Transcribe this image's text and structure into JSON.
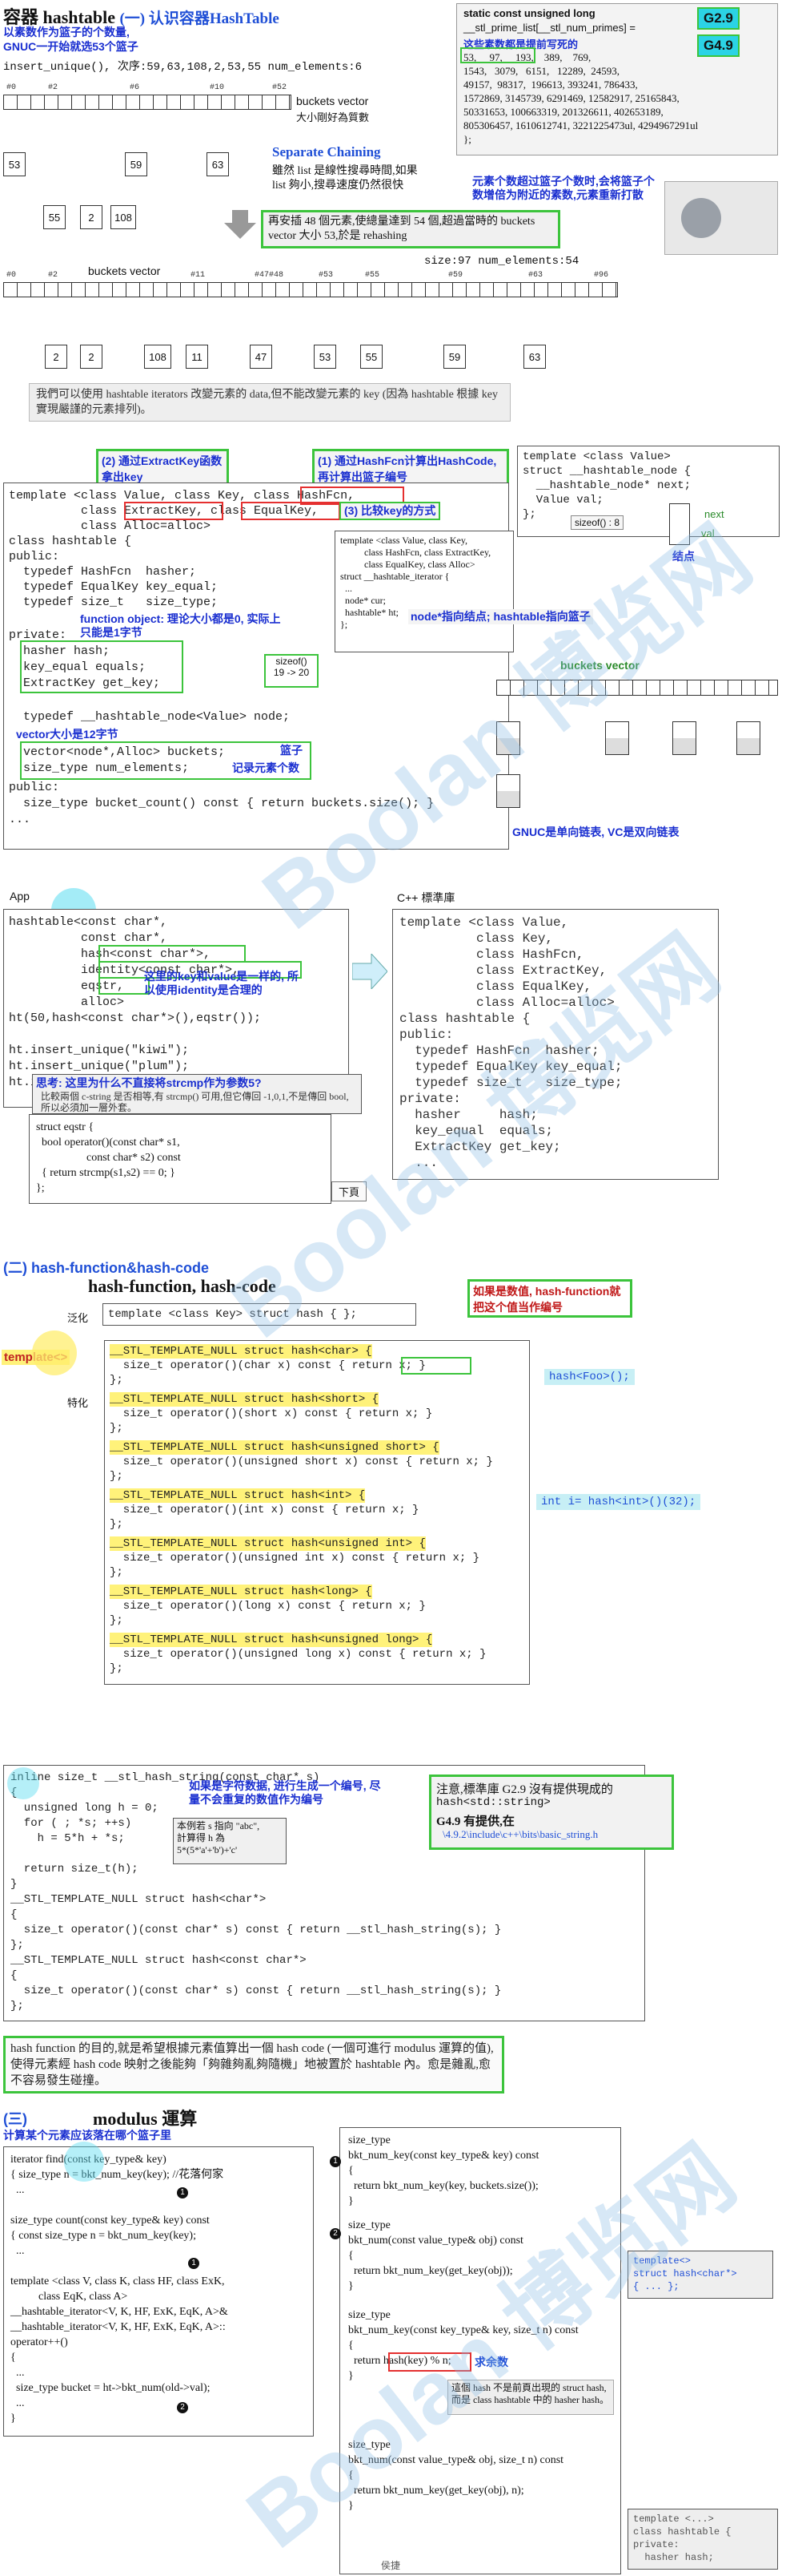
{
  "section1": {
    "title": "容器 hashtable",
    "title_sub": "(一) 认识容器HashTable",
    "note1": "以素数作为篮子的个数量,",
    "note2": "GNUC一开始就选53个篮子",
    "insert_line": "insert_unique(), 次序:59,63,108,2,53,55 num_elements:6",
    "prime_title": "static const unsigned long",
    "prime_line1": "__stl_prime_list[__stl_num_primes] =",
    "prime_note": "这些素数都是提前写死的",
    "primes": "53,     97,     193,    389,    769,\n1543,   3079,   6151,   12289,  24593,\n49157,  98317,  196613, 393241, 786433,\n1572869, 3145739, 6291469, 12582917, 25165843,\n50331653, 100663319, 201326611, 402653189,\n805306457, 1610612741, 3221225473ul, 4294967291ul\n};",
    "g29": "G2.9",
    "g49": "G4.9",
    "bucket_ticks_top": [
      "#0",
      "#2",
      "#6",
      "#10",
      "#52"
    ],
    "buckets_label_top": "buckets vector",
    "buckets_label_top_sub": "大小剛好為質數",
    "top_nodes": [
      "53",
      "59",
      "63",
      "55",
      "2",
      "108"
    ],
    "sep_chain": "Separate Chaining",
    "sep_chain_text1": "雖然 list 是線性搜尋時間,如果",
    "sep_chain_text2": "list 夠小,搜尋速度仍然很快",
    "rehash_note": "元素个数超过篮子个数时,会将篮子个数增倍为附近的素数,元素重新打散",
    "rehash_text": "再安插 48 個元素,使總量達到 54 個,超過當時的 buckets vector 大小 53,於是 rehashing",
    "size_line": "size:97  num_elements:54",
    "bucket_ticks_mid": [
      "#0",
      "#2",
      "#11",
      "#47#48",
      "#53",
      "#55",
      "#59",
      "#63",
      "#96"
    ],
    "buckets_label_mid": "buckets vector",
    "mid_nodes": [
      "2",
      "2",
      "108",
      "11",
      "47",
      "53",
      "55",
      "59",
      "63"
    ],
    "iter_text": "我們可以使用 hashtable iterators 改變元素的 data,但不能改變元素的 key (因為 hashtable 根據 key 實現嚴謹的元素排列)。"
  },
  "section2": {
    "ann_extractkey": "(2) 通过ExtractKey函数拿出key",
    "ann_hashfcn": "(1) 通过HashFcn计算出HashCode, 再计算出篮子编号",
    "ann_equalkey": "(3) 比较key的方式",
    "code_lines": [
      "template <class Value, class Key, class HashFcn,",
      "          class ExtractKey, class EqualKey,",
      "          class Alloc=alloc>",
      "class hashtable {",
      "public:",
      "  typedef HashFcn  hasher;",
      "  typedef EqualKey key_equal;",
      "  typedef size_t   size_type;",
      "private:",
      "  hasher hash;",
      "  key_equal equals;",
      "  ExtractKey get_key;",
      "",
      "  typedef __hashtable_node<Value> node;",
      "",
      "  vector<node*,Alloc> buckets;",
      "  size_type num_elements;",
      "public:",
      "  size_type bucket_count() const { return buckets.size(); }",
      "..."
    ],
    "fn_object_note": "function object: 理论大小都是0, 实际上只能是1字节",
    "vector_note": "vector大小是12字节",
    "bucket_note": "篮子",
    "elem_note": "记录元素个数",
    "sizeof_box": "sizeof()",
    "sizeof_box_val": "19 -> 20",
    "node_code": "template <class Value>\nstruct __hashtable_node {\n  __hashtable_node* next;\n  Value val;\n};",
    "node_sizeof": "sizeof() : 8",
    "node_next": "next",
    "node_val": "val",
    "node_label": "结点",
    "iter_code": "template <class Value, class Key,\n          class HashFcn, class ExtractKey,\n          class EqualKey, class Alloc>\nstruct __hashtable_iterator {\n  ...\n  node* cur;\n  hashtable* ht;\n};",
    "node_ptr_note": "node*指向结点; hashtable指向篮子",
    "buckets_vector": "buckets  vector",
    "gnuc_note": "GNUC是单向链表, VC是双向链表"
  },
  "section3": {
    "app_label": "App",
    "std_label": "C++ 標準庫",
    "app_code": "hashtable<const char*,\n          const char*,\n          hash<const char*>,\n          identity<const char*>,\n          eqstr,\n          alloc>\nht(50,hash<const char*>(),eqstr());\n\nht.insert_unique(\"kiwi\");\nht.insert_unique(\"plum\");\nht.insert_unique(\"apple\");",
    "same_note": "这里的key和value是一样的, 所以使用identity是合理的",
    "think_note": "思考: 这里为什么不直接将strcmp作为参数5?",
    "think_text": "比較兩個 c-string 是否相等,有 strcmp() 可用,但它傳回 -1,0,1,不是傳回 bool,所以必須加一層外套。",
    "eqstr_code": "struct eqstr {\n  bool operator()(const char* s1,\n                  const char* s2) const\n  { return strcmp(s1,s2) == 0; }\n};",
    "next_page": "下頁",
    "std_code": "template <class Value,\n          class Key,\n          class HashFcn,\n          class ExtractKey,\n          class EqualKey,\n          class Alloc=alloc>\nclass hashtable {\npublic:\n  typedef HashFcn  hasher;\n  typedef EqualKey key_equal;\n  typedef size_t   size_type;\nprivate:\n  hasher     hash;\n  key_equal  equals;\n  ExtractKey get_key;\n  ..."
  },
  "section4": {
    "title": "(二) hash-function&hash-code",
    "subtitle": "hash-function, hash-code",
    "generalize": "泛化",
    "template_label": "template<>",
    "specialize": "特化",
    "generic_decl": "template <class Key> struct hash { };",
    "num_note": "如果是数值, hash-function就把这个值当作编号",
    "hash_foo": "hash<Foo>();",
    "int_example": "int i= hash<int>()(32);",
    "spec_blocks": [
      [
        "__STL_TEMPLATE_NULL struct hash<char> {",
        "  size_t operator()(char x) const { return x; }",
        "};"
      ],
      [
        "__STL_TEMPLATE_NULL struct hash<short> {",
        "  size_t operator()(short x) const { return x; }",
        "};"
      ],
      [
        "__STL_TEMPLATE_NULL struct hash<unsigned short> {",
        "  size_t operator()(unsigned short x) const { return x; }",
        "};"
      ],
      [
        "__STL_TEMPLATE_NULL struct hash<int> {",
        "  size_t operator()(int x) const { return x; }",
        "};"
      ],
      [
        "__STL_TEMPLATE_NULL struct hash<unsigned int> {",
        "  size_t operator()(unsigned int x) const { return x; }",
        "};"
      ],
      [
        "__STL_TEMPLATE_NULL struct hash<long> {",
        "  size_t operator()(long x) const { return x; }",
        "};"
      ],
      [
        "__STL_TEMPLATE_NULL struct hash<unsigned long> {",
        "  size_t operator()(unsigned long x) const { return x; }",
        "};"
      ]
    ]
  },
  "section5": {
    "string_code": "inline size_t __stl_hash_string(const char* s)\n{\n  unsigned long h = 0;\n  for ( ; *s; ++s)\n    h = 5*h + *s;\n\n  return size_t(h);\n}\n__STL_TEMPLATE_NULL struct hash<char*>\n{\n  size_t operator()(const char* s) const { return __stl_hash_string(s); }\n};\n__STL_TEMPLATE_NULL struct hash<const char*>\n{\n  size_t operator()(const char* s) const { return __stl_hash_string(s); }\n};",
    "string_note": "如果是字符数据, 进行生成一个编号, 尽量不会重复的数值作为编号",
    "abc_note": "本例若 s 指向 \"abc\",\n計算得 h 為\n5*(5*'a'+'b')+'c'",
    "std_note_title": "注意,標準庫 G2.9 沒有提供現成的",
    "std_note_line2": "hash<std::string>",
    "std_note_line3": "G4.9 有提供,在",
    "std_note_path": "\\4.9.2\\include\\c++\\bits\\basic_string.h",
    "purpose_text": "hash function 的目的,就是希望根據元素值算出一個 hash code (一個可進行 modulus 運算的值),使得元素經 hash code 映射之後能夠「夠雜夠亂夠隨機」地被置於 hashtable 內。愈是雜亂,愈不容易發生碰撞。"
  },
  "section6": {
    "section_num": "(三)",
    "title": "modulus 運算",
    "subtitle": "计算某个元素应该落在哪个篮子里",
    "left_code": "iterator find(const key_type& key)\n{ size_type n = bkt_num_key(key); //花落何家\n  ...\n\nsize_type count(const key_type& key) const\n{ const size_type n = bkt_num_key(key);\n  ...\n\ntemplate <class V, class K, class HF, class ExK,\n          class EqK, class A>\n__hashtable_iterator<V, K, HF, ExK, EqK, A>&\n__hashtable_iterator<V, K, HF, ExK, EqK, A>::\noperator++()\n{\n  ...\n  size_type bucket = ht->bkt_num(old->val);\n  ...\n}",
    "right_code1": "size_type\nbkt_num_key(const key_type& key) const\n{\n  return bkt_num_key(key, buckets.size());\n}",
    "right_code2": "size_type\nbkt_num(const value_type& obj) const\n{\n  return bkt_num_key(get_key(obj));\n}",
    "right_code3": "size_type\nbkt_num_key(const key_type& key, size_t n) const\n{\n  return hash(key) % n;\n}",
    "right_code4": "size_type\nbkt_num(const value_type& obj, size_t n) const\n{\n  return bkt_num_key(get_key(obj), n);\n}",
    "mod_note": "求余数",
    "hash_note": "這個 hash 不是前頁出現的 struct hash,而是 class hashtable 中的 hasher hash。",
    "side_box1": "template<>\nstruct hash<char*>\n{ ... };",
    "side_box2": "template <...>\nclass hashtable {\nprivate:\n  hasher hash;",
    "footer": "侯捷"
  },
  "watermark": [
    "Boolan 博览网",
    "Boolan 博览网",
    "Boolan 博览网"
  ],
  "colors": {
    "accent_blue": "#1f4fd6",
    "green": "#3cc43c",
    "red": "#e02020",
    "yellow": "#fff27a",
    "purple": "#9b1e9b"
  }
}
